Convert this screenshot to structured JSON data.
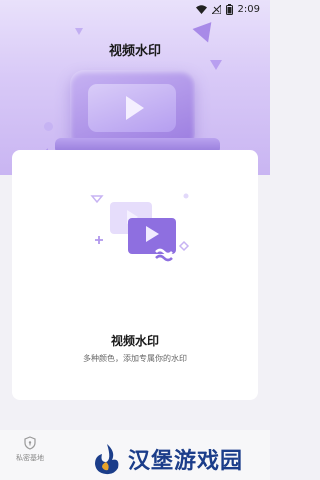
{
  "status_bar": {
    "time": "2:09",
    "icons": [
      "wifi-icon",
      "no-signal-icon",
      "battery-icon"
    ]
  },
  "header": {
    "title": "视频水印"
  },
  "card": {
    "title": "视频水印",
    "subtitle": "多种颜色，添加专属你的水印"
  },
  "bottom_nav": {
    "items": [
      {
        "label": "私密基地",
        "icon": "shield-icon"
      }
    ]
  },
  "watermark": {
    "text": "汉堡游戏园"
  },
  "colors": {
    "accent": "#9b7ce0",
    "hero_top": "#e9e1fb",
    "hero_bottom": "#c9b5f2"
  }
}
